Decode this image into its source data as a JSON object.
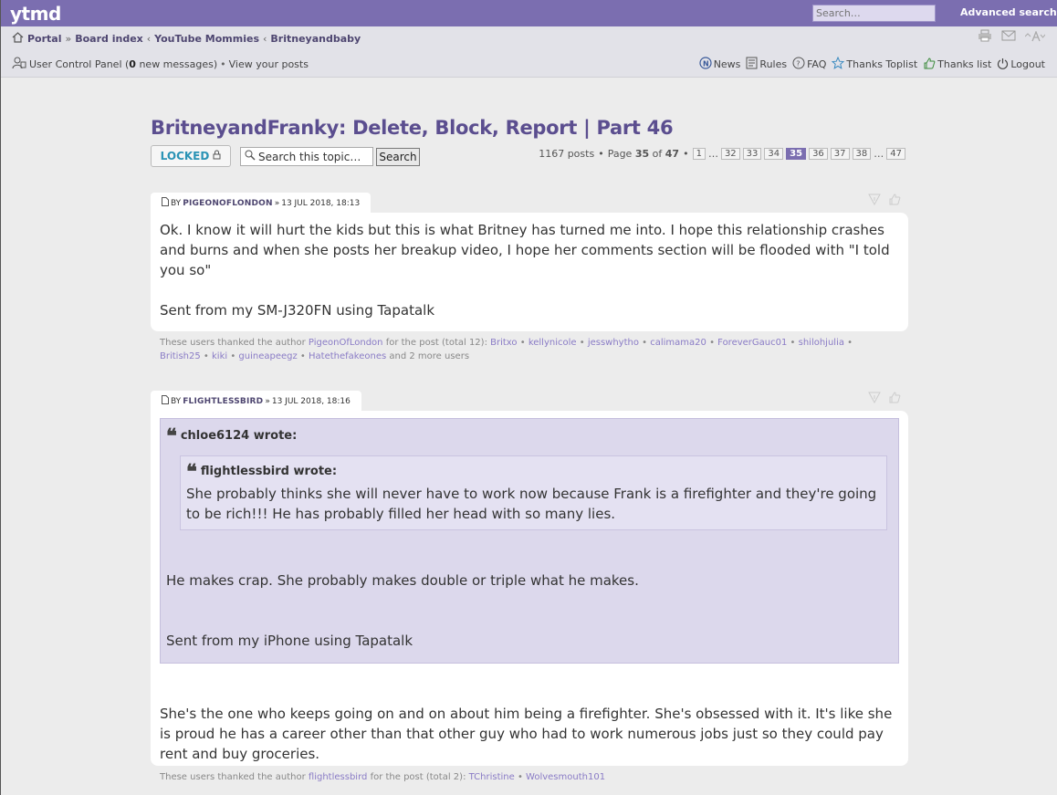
{
  "header": {
    "logo": "ytmd",
    "search_placeholder": "Search…",
    "advanced_search": "Advanced search"
  },
  "breadcrumbs": [
    "Portal",
    "Board index",
    "YouTube Mommies",
    "Britneyandbaby"
  ],
  "breadcrumb_seps": [
    "»",
    "‹",
    "‹"
  ],
  "user_bar": {
    "ucp": "User Control Panel (",
    "count": "0",
    "new_messages": " new messages)",
    "view_posts": "View your posts"
  },
  "quick_links": [
    "News",
    "Rules",
    "FAQ",
    "Thanks Toplist",
    "Thanks list",
    "Logout"
  ],
  "topic": {
    "title": "BritneyandFranky: Delete, Block, Report | Part 46",
    "locked_label": "LOCKED",
    "search_placeholder": "Search this topic…",
    "search_button": "Search",
    "posts_count": "1167 posts",
    "page_prefix": "Page",
    "page_current": "35",
    "page_of": "of",
    "page_total": "47",
    "pages": [
      "1",
      "…",
      "32",
      "33",
      "34",
      "35",
      "36",
      "37",
      "38",
      "…",
      "47"
    ],
    "active_page": "35"
  },
  "posts": [
    {
      "by": "BY",
      "author": "PigeonOfLondon",
      "date": "13 Jul 2018, 18:13",
      "paragraphs": [
        "Ok. I know it will hurt the kids but this is what Britney has turned me into. I hope this relationship crashes and burns and when she posts her breakup video, I hope her comments section will be flooded with \"I told you so\"",
        "Sent from my SM-J320FN using Tapatalk"
      ],
      "thanks_prefix": "These users thanked the author",
      "thanks_author": "PigeonOfLondon",
      "thanks_total": "for the post (total 12):",
      "thanks_users": [
        "Britxo",
        "kellynicole",
        "jesswhytho",
        "calimama20",
        "ForeverGauc01",
        "shilohjulia",
        "British25",
        "kiki",
        "guineapeegz",
        "Hatethefakeones"
      ],
      "thanks_more": "and 2 more users"
    },
    {
      "by": "BY",
      "author": "flightlessbird",
      "date": "13 Jul 2018, 18:16",
      "quote_outer_author": "chloe6124 wrote:",
      "quote_inner_author": "flightlessbird wrote:",
      "quote_inner_text": "She probably thinks she will never have to work now because Frank is a firefighter and they're going to be rich!!! He has probably filled her head with so many lies.",
      "quote_outer_p1": "He makes crap. She probably makes double or triple what he makes.",
      "quote_outer_p2": "Sent from my iPhone using Tapatalk",
      "reply": "She's the one who keeps going on and on about him being a firefighter. She's obsessed with it. It's like she is proud he has a career other than that other guy who had to work numerous jobs just so they could pay rent and buy groceries.",
      "thanks_prefix": "These users thanked the author",
      "thanks_author": "flightlessbird",
      "thanks_total": "for the post (total 2):",
      "thanks_users": [
        "TChristine",
        "Wolvesmouth101"
      ]
    }
  ],
  "colors": {
    "header_bg": "#7b6eb0",
    "title": "#5b4e8f",
    "locked": "#2a93b5",
    "link": "#8a7cc6"
  }
}
